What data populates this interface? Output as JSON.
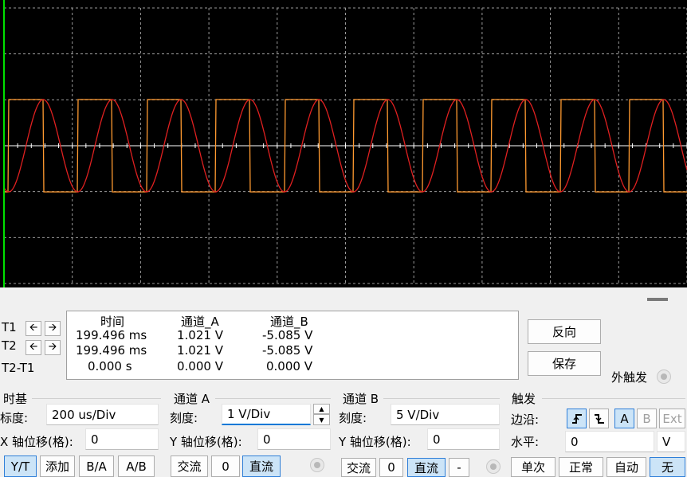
{
  "readout": {
    "row_labels": [
      "T1",
      "T2",
      "T2-T1"
    ],
    "headers": [
      "时间",
      "通道_A",
      "通道_B"
    ],
    "rows": [
      [
        "199.496 ms",
        "1.021 V",
        "-5.085 V"
      ],
      [
        "199.496 ms",
        "1.021 V",
        "-5.085 V"
      ],
      [
        "0.000 s",
        "0.000 V",
        "0.000 V"
      ]
    ]
  },
  "side_buttons": {
    "reverse": "反向",
    "save": "保存",
    "ext_trigger": "外触发"
  },
  "timebase": {
    "title": "时基",
    "scale_label": "标度:",
    "scale_value": "200 us/Div",
    "xpos_label": "X 轴位移(格):",
    "xpos_value": "0",
    "modes": [
      "Y/T",
      "添加",
      "B/A",
      "A/B"
    ]
  },
  "channel_a": {
    "title": "通道 A",
    "scale_label": "刻度:",
    "scale_value": "1  V/Div",
    "ypos_label": "Y 轴位移(格):",
    "ypos_value": "0",
    "coupling": [
      "交流",
      "0",
      "直流"
    ]
  },
  "channel_b": {
    "title": "通道 B",
    "scale_label": "刻度:",
    "scale_value": "5  V/Div",
    "ypos_label": "Y 轴位移(格):",
    "ypos_value": "0",
    "coupling": [
      "交流",
      "0",
      "直流",
      "-"
    ]
  },
  "trigger": {
    "title": "触发",
    "edge_label": "边沿:",
    "level_label": "水平:",
    "level_value": "0",
    "level_unit": "V",
    "sources": [
      "A",
      "B",
      "Ext"
    ],
    "modes": [
      "单次",
      "正常",
      "自动",
      "无"
    ]
  },
  "colors": {
    "channel_a": "#e02020",
    "channel_b": "#ff9a30",
    "cursor": "#00e000",
    "grid": "#9a9a9a",
    "screen": "#000000"
  }
}
